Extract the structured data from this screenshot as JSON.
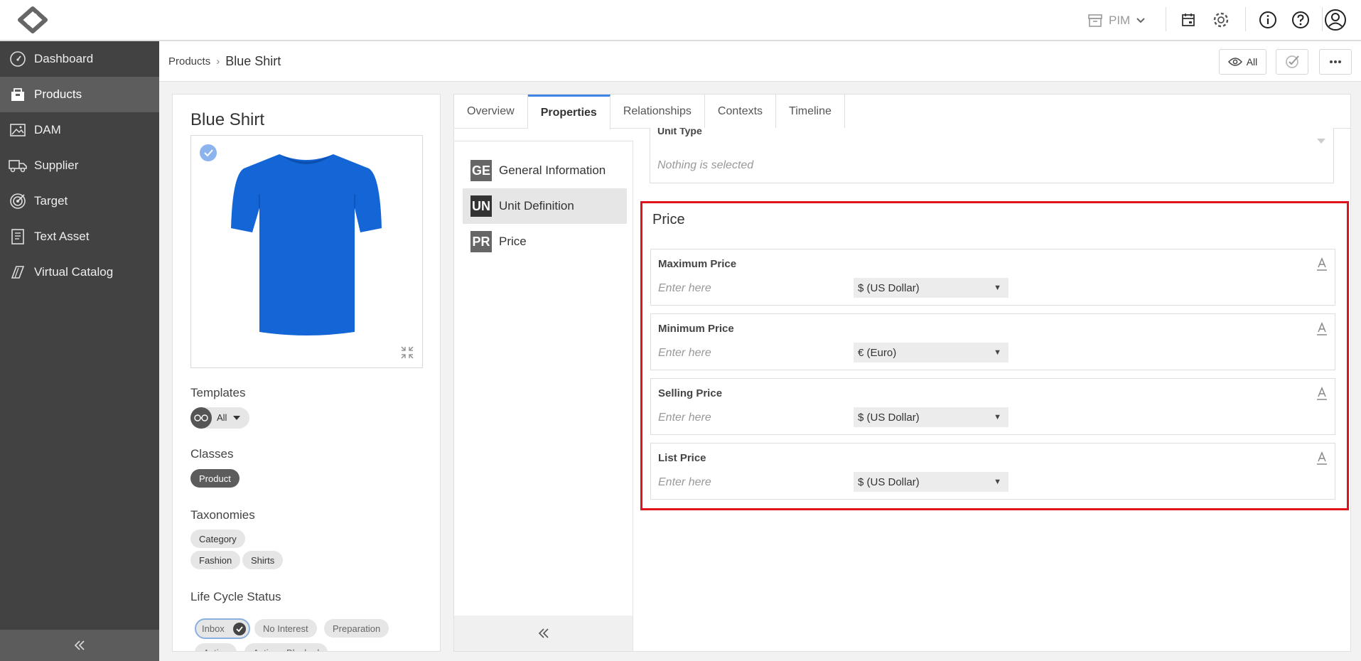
{
  "topbar": {
    "module_label": "PIM",
    "icons": [
      "logo-icon",
      "archive-icon",
      "calendar-icon",
      "gear-icon",
      "info-icon",
      "help-icon",
      "user-avatar-icon"
    ]
  },
  "sidebar": {
    "items": [
      {
        "label": "Dashboard",
        "icon": "dashboard-icon"
      },
      {
        "label": "Products",
        "icon": "products-icon"
      },
      {
        "label": "DAM",
        "icon": "image-icon"
      },
      {
        "label": "Supplier",
        "icon": "truck-icon"
      },
      {
        "label": "Target",
        "icon": "target-icon"
      },
      {
        "label": "Text Asset",
        "icon": "document-icon"
      },
      {
        "label": "Virtual Catalog",
        "icon": "book-icon"
      }
    ],
    "active": "Products"
  },
  "header": {
    "breadcrumb_root": "Products",
    "breadcrumb_separator": "›",
    "breadcrumb_current": "Blue Shirt",
    "view_button_label": "All"
  },
  "product": {
    "title": "Blue Shirt",
    "templates_label": "Templates",
    "template_value": "All",
    "classes_label": "Classes",
    "class_chip": "Product",
    "taxonomies_label": "Taxonomies",
    "taxonomy_chips": [
      "Category",
      "Fashion",
      "Shirts"
    ],
    "lifecycle_label": "Life Cycle Status",
    "lifecycle_chips": [
      "Inbox",
      "No Interest",
      "Preparation",
      "Active",
      "Active - Blocked"
    ]
  },
  "tabs": [
    "Overview",
    "Properties",
    "Relationships",
    "Contexts",
    "Timeline"
  ],
  "active_tab": "Properties",
  "section_nav": [
    {
      "abbr": "GE",
      "label": "General Information"
    },
    {
      "abbr": "UN",
      "label": "Unit Definition"
    },
    {
      "abbr": "PR",
      "label": "Price"
    }
  ],
  "unit_type": {
    "label": "Unit Type",
    "placeholder": "Nothing is selected"
  },
  "price_section": {
    "title": "Price",
    "fields": [
      {
        "label": "Maximum Price",
        "placeholder": "Enter here",
        "currency": "$ (US Dollar)"
      },
      {
        "label": "Minimum Price",
        "placeholder": "Enter here",
        "currency": "€ (Euro)"
      },
      {
        "label": "Selling Price",
        "placeholder": "Enter here",
        "currency": "$ (US Dollar)"
      },
      {
        "label": "List Price",
        "placeholder": "Enter here",
        "currency": "$ (US Dollar)"
      }
    ]
  },
  "colors": {
    "sidebar_bg": "#424242",
    "accent_tab": "#3d84e6",
    "highlight_border": "#e0121b",
    "shirt_blue": "#1466d6"
  }
}
